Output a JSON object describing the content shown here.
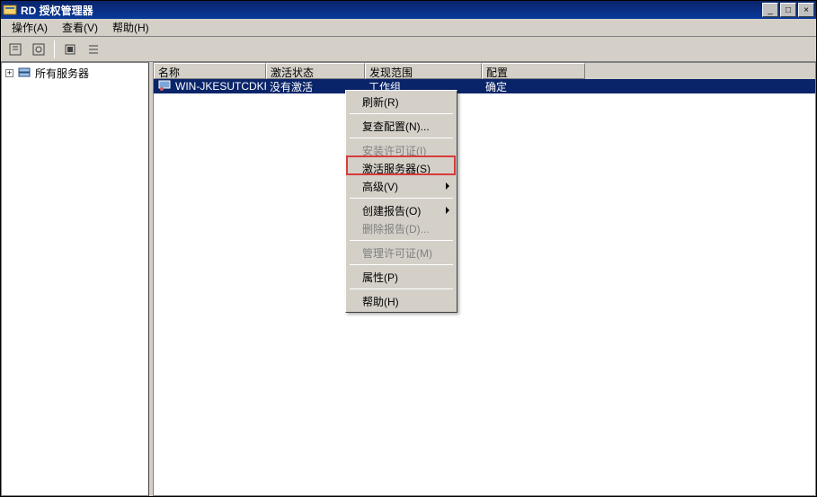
{
  "window": {
    "title": "RD 授权管理器"
  },
  "menu": {
    "action": "操作(A)",
    "view": "查看(V)",
    "help": "帮助(H)"
  },
  "tree": {
    "root": "所有服务器"
  },
  "columns": {
    "name": "名称",
    "activation": "激活状态",
    "scope": "发现范围",
    "config": "配置"
  },
  "row": {
    "name": "WIN-JKESUTCDKFE",
    "activation": "没有激活",
    "scope": "工作组",
    "config": "确定"
  },
  "context_menu": {
    "refresh": "刷新(R)",
    "review_config": "复查配置(N)...",
    "install_license": "安装许可证(I)",
    "activate_server": "激活服务器(S)",
    "advanced": "高级(V)",
    "create_report": "创建报告(O)",
    "delete_report": "删除报告(D)...",
    "manage_license": "管理许可证(M)",
    "properties": "属性(P)",
    "help": "帮助(H)"
  },
  "win_btns": {
    "min": "_",
    "max": "□",
    "close": "×"
  }
}
